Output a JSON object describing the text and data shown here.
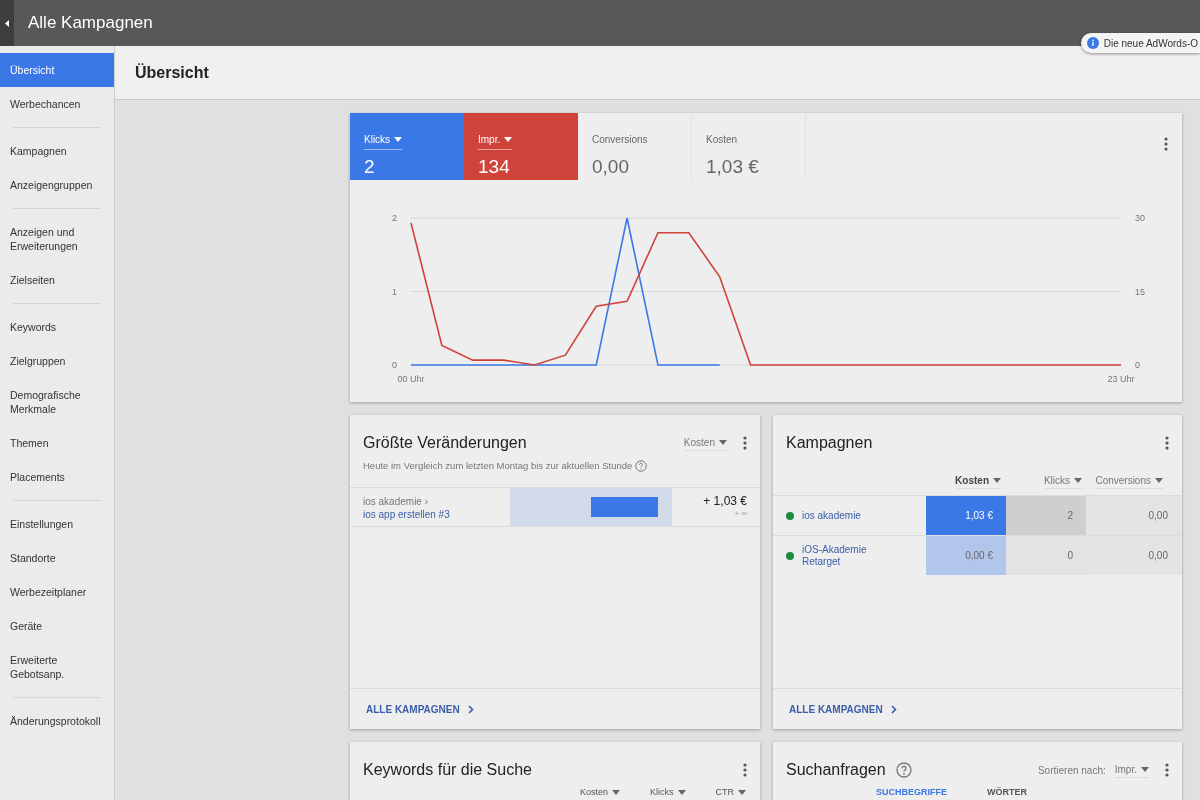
{
  "top_bar": {
    "title": "Alle Kampagnen",
    "notice": "Die neue AdWords-O"
  },
  "sidebar": {
    "sections": [
      {
        "items": [
          {
            "label": "Übersicht",
            "selected": true
          },
          {
            "label": "Werbechancen",
            "selected": false
          }
        ]
      },
      {
        "items": [
          {
            "label": "Kampagnen",
            "selected": false
          },
          {
            "label": "Anzeigengruppen",
            "selected": false
          }
        ]
      },
      {
        "items": [
          {
            "label": "Anzeigen und Erweiterungen",
            "selected": false
          },
          {
            "label": "Zielseiten",
            "selected": false
          }
        ]
      },
      {
        "items": [
          {
            "label": "Keywords",
            "selected": false
          },
          {
            "label": "Zielgruppen",
            "selected": false
          },
          {
            "label": "Demografische Merkmale",
            "selected": false
          },
          {
            "label": "Themen",
            "selected": false
          },
          {
            "label": "Placements",
            "selected": false
          }
        ]
      },
      {
        "items": [
          {
            "label": "Einstellungen",
            "selected": false
          },
          {
            "label": "Standorte",
            "selected": false
          },
          {
            "label": "Werbezeitplaner",
            "selected": false
          },
          {
            "label": "Geräte",
            "selected": false
          },
          {
            "label": "Erweiterte Gebotsanp.",
            "selected": false
          }
        ]
      },
      {
        "items": [
          {
            "label": "Änderungsprotokoll",
            "selected": false
          }
        ]
      }
    ]
  },
  "page_title": "Übersicht",
  "performance": {
    "metrics": [
      {
        "label": "Klicks",
        "value": "2",
        "selected": true,
        "color": "#3b78e7"
      },
      {
        "label": "Impr.",
        "value": "134",
        "selected": true,
        "color": "#d0433a"
      },
      {
        "label": "Conversions",
        "value": "0,00",
        "selected": false
      },
      {
        "label": "Kosten",
        "value": "1,03 €",
        "selected": false
      }
    ],
    "chart_data": {
      "type": "line",
      "xlim": [
        0,
        23
      ],
      "x": [
        0,
        1,
        2,
        3,
        4,
        5,
        6,
        7,
        8,
        9,
        10,
        11,
        12,
        13,
        14,
        15,
        16,
        17,
        18,
        19,
        20,
        21,
        22,
        23
      ],
      "xticks": [
        {
          "value": 0,
          "label": "00 Uhr"
        },
        {
          "value": 23,
          "label": "23 Uhr"
        }
      ],
      "yticks": [
        0,
        1,
        2
      ],
      "ylim": [
        0,
        2
      ],
      "y2ticks": [
        0,
        15,
        30
      ],
      "y2lim": [
        0,
        30
      ],
      "series": [
        {
          "color": "#3b78e7",
          "values": [
            0,
            0,
            0,
            0,
            0,
            0,
            0,
            2,
            0,
            0,
            0,
            null,
            null,
            null,
            null,
            null,
            null,
            null,
            null,
            null,
            null,
            null,
            null,
            null
          ]
        },
        {
          "color": "#d0433a",
          "axis": "y2",
          "values": [
            29,
            4,
            1,
            1,
            0,
            2,
            12,
            13,
            27,
            27,
            18,
            0,
            0,
            0,
            0,
            0,
            0,
            0,
            0,
            0,
            0,
            0,
            0,
            0
          ]
        }
      ]
    }
  },
  "changes": {
    "title": "Größte Veränderungen",
    "sort": "Kosten",
    "subtitle": "Heute im Vergleich zum letzten Montag bis zur aktuellen Stunde",
    "rows": [
      {
        "campaign": "ios akademie ›",
        "ad_group": "ios app erstellen #3",
        "level": 0.83,
        "change": "+ 1,03 €",
        "percent": "+ ∞"
      }
    ],
    "link": "ALLE KAMPAGNEN"
  },
  "campaigns": {
    "title": "Kampagnen",
    "columns": [
      {
        "label": "Kosten",
        "selected": true,
        "color": "#3b78e7"
      },
      {
        "label": "Klicks",
        "selected": false,
        "color": "#cfcfcf"
      },
      {
        "label": "Conversions",
        "selected": false,
        "color": "#e4e4e4"
      }
    ],
    "rows": [
      {
        "name": "ios akademie",
        "color": "#1e8e3e",
        "cells": [
          {
            "text": "1,03 €",
            "highlighted": true
          },
          {
            "text": "2",
            "highlighted": true
          },
          {
            "text": "0,00"
          }
        ]
      },
      {
        "name": "iOS-Akademie Retarget",
        "color": "#1e8e3e",
        "cells": [
          {
            "text": "0,00 €",
            "highlighted": false
          },
          {
            "text": "0",
            "highlighted": false
          },
          {
            "text": "0,00"
          }
        ]
      }
    ],
    "link": "ALLE KAMPAGNEN"
  },
  "keywords": {
    "title": "Keywords für die Suche",
    "columns": [
      "Kosten",
      "Klicks",
      "CTR"
    ]
  },
  "search_terms": {
    "title": "Suchanfragen",
    "sort_label": "Sortieren nach:",
    "sort": "Impr.",
    "tabs": [
      {
        "label": "SUCHBEGRIFFE",
        "selected": true
      },
      {
        "label": "WÖRTER",
        "selected": false
      }
    ]
  }
}
